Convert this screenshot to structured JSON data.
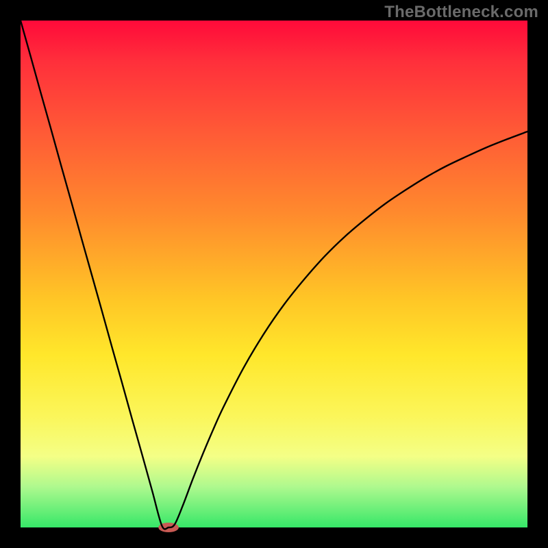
{
  "watermark": "TheBottleneck.com",
  "colors": {
    "frame": "#000000",
    "watermark": "#6a6a6a",
    "curve": "#000000",
    "marker": "#c85a54",
    "gradient_stops": [
      "#ff0a3a",
      "#ff2f3b",
      "#ff5a36",
      "#ff8a2d",
      "#ffc626",
      "#ffe72b",
      "#fbf65a",
      "#f4ff86",
      "#aef98e",
      "#36e768"
    ]
  },
  "chart_data": {
    "type": "line",
    "title": "",
    "xlabel": "",
    "ylabel": "",
    "xlim": [
      0,
      100
    ],
    "ylim": [
      0,
      100
    ],
    "grid": false,
    "legend": false,
    "note": "Axes are unlabeled in the source image; values are the curve trace read in percent of plot width (x) and plot height (y), y=0 at bottom.",
    "series": [
      {
        "name": "curve",
        "x": [
          0,
          2,
          4,
          6,
          8,
          10,
          12,
          14,
          16,
          18,
          20,
          22,
          24,
          26,
          27.9,
          29.2,
          30.4,
          32,
          34,
          36,
          38,
          40,
          44,
          48,
          52,
          56,
          60,
          64,
          68,
          72,
          76,
          80,
          84,
          88,
          92,
          96,
          100
        ],
        "y": [
          100,
          92.9,
          85.7,
          78.6,
          71.4,
          64.3,
          57.1,
          50,
          42.9,
          35.7,
          28.6,
          21.4,
          14.3,
          7.1,
          0.3,
          0,
          0.6,
          4.3,
          9.6,
          14.6,
          19.3,
          23.7,
          31.5,
          38.2,
          44,
          49,
          53.5,
          57.4,
          60.8,
          63.9,
          66.6,
          69.1,
          71.3,
          73.2,
          75,
          76.6,
          78.1
        ]
      }
    ],
    "marker": {
      "x": 29.2,
      "y": 0,
      "rx_pct": 2.0,
      "ry_pct": 0.95
    }
  }
}
